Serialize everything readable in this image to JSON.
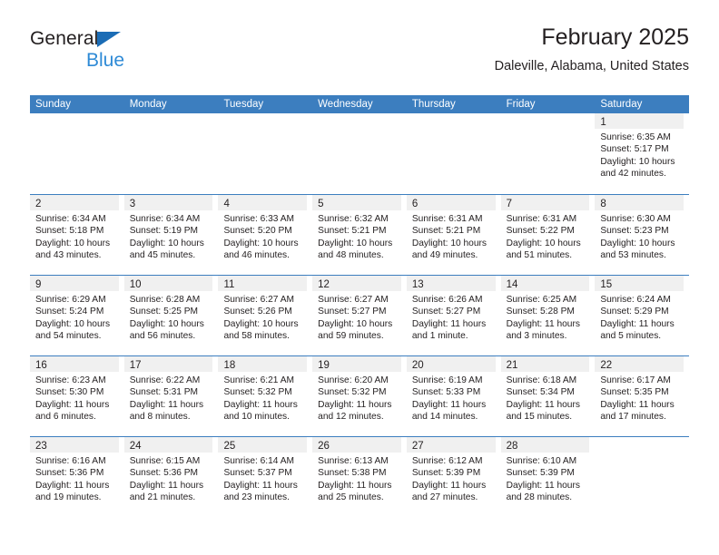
{
  "brand": {
    "name_part1": "General",
    "name_part2": "Blue",
    "triangle_icon": "triangle-icon"
  },
  "header": {
    "title": "February 2025",
    "subtitle": "Daleville, Alabama, United States"
  },
  "colors": {
    "header_blue": "#3c7ebf",
    "brand_blue": "#2e8ad6",
    "logo_triangle_blue": "#1b6cb5",
    "day_band_grey": "#f0f0f0",
    "text": "#231f20"
  },
  "calendar": {
    "weekday_headers": [
      "Sunday",
      "Monday",
      "Tuesday",
      "Wednesday",
      "Thursday",
      "Friday",
      "Saturday"
    ],
    "weeks": [
      [
        {
          "day": "",
          "lines": []
        },
        {
          "day": "",
          "lines": []
        },
        {
          "day": "",
          "lines": []
        },
        {
          "day": "",
          "lines": []
        },
        {
          "day": "",
          "lines": []
        },
        {
          "day": "",
          "lines": []
        },
        {
          "day": "1",
          "lines": [
            "Sunrise: 6:35 AM",
            "Sunset: 5:17 PM",
            "Daylight: 10 hours",
            "and 42 minutes."
          ]
        }
      ],
      [
        {
          "day": "2",
          "lines": [
            "Sunrise: 6:34 AM",
            "Sunset: 5:18 PM",
            "Daylight: 10 hours",
            "and 43 minutes."
          ]
        },
        {
          "day": "3",
          "lines": [
            "Sunrise: 6:34 AM",
            "Sunset: 5:19 PM",
            "Daylight: 10 hours",
            "and 45 minutes."
          ]
        },
        {
          "day": "4",
          "lines": [
            "Sunrise: 6:33 AM",
            "Sunset: 5:20 PM",
            "Daylight: 10 hours",
            "and 46 minutes."
          ]
        },
        {
          "day": "5",
          "lines": [
            "Sunrise: 6:32 AM",
            "Sunset: 5:21 PM",
            "Daylight: 10 hours",
            "and 48 minutes."
          ]
        },
        {
          "day": "6",
          "lines": [
            "Sunrise: 6:31 AM",
            "Sunset: 5:21 PM",
            "Daylight: 10 hours",
            "and 49 minutes."
          ]
        },
        {
          "day": "7",
          "lines": [
            "Sunrise: 6:31 AM",
            "Sunset: 5:22 PM",
            "Daylight: 10 hours",
            "and 51 minutes."
          ]
        },
        {
          "day": "8",
          "lines": [
            "Sunrise: 6:30 AM",
            "Sunset: 5:23 PM",
            "Daylight: 10 hours",
            "and 53 minutes."
          ]
        }
      ],
      [
        {
          "day": "9",
          "lines": [
            "Sunrise: 6:29 AM",
            "Sunset: 5:24 PM",
            "Daylight: 10 hours",
            "and 54 minutes."
          ]
        },
        {
          "day": "10",
          "lines": [
            "Sunrise: 6:28 AM",
            "Sunset: 5:25 PM",
            "Daylight: 10 hours",
            "and 56 minutes."
          ]
        },
        {
          "day": "11",
          "lines": [
            "Sunrise: 6:27 AM",
            "Sunset: 5:26 PM",
            "Daylight: 10 hours",
            "and 58 minutes."
          ]
        },
        {
          "day": "12",
          "lines": [
            "Sunrise: 6:27 AM",
            "Sunset: 5:27 PM",
            "Daylight: 10 hours",
            "and 59 minutes."
          ]
        },
        {
          "day": "13",
          "lines": [
            "Sunrise: 6:26 AM",
            "Sunset: 5:27 PM",
            "Daylight: 11 hours",
            "and 1 minute."
          ]
        },
        {
          "day": "14",
          "lines": [
            "Sunrise: 6:25 AM",
            "Sunset: 5:28 PM",
            "Daylight: 11 hours",
            "and 3 minutes."
          ]
        },
        {
          "day": "15",
          "lines": [
            "Sunrise: 6:24 AM",
            "Sunset: 5:29 PM",
            "Daylight: 11 hours",
            "and 5 minutes."
          ]
        }
      ],
      [
        {
          "day": "16",
          "lines": [
            "Sunrise: 6:23 AM",
            "Sunset: 5:30 PM",
            "Daylight: 11 hours",
            "and 6 minutes."
          ]
        },
        {
          "day": "17",
          "lines": [
            "Sunrise: 6:22 AM",
            "Sunset: 5:31 PM",
            "Daylight: 11 hours",
            "and 8 minutes."
          ]
        },
        {
          "day": "18",
          "lines": [
            "Sunrise: 6:21 AM",
            "Sunset: 5:32 PM",
            "Daylight: 11 hours",
            "and 10 minutes."
          ]
        },
        {
          "day": "19",
          "lines": [
            "Sunrise: 6:20 AM",
            "Sunset: 5:32 PM",
            "Daylight: 11 hours",
            "and 12 minutes."
          ]
        },
        {
          "day": "20",
          "lines": [
            "Sunrise: 6:19 AM",
            "Sunset: 5:33 PM",
            "Daylight: 11 hours",
            "and 14 minutes."
          ]
        },
        {
          "day": "21",
          "lines": [
            "Sunrise: 6:18 AM",
            "Sunset: 5:34 PM",
            "Daylight: 11 hours",
            "and 15 minutes."
          ]
        },
        {
          "day": "22",
          "lines": [
            "Sunrise: 6:17 AM",
            "Sunset: 5:35 PM",
            "Daylight: 11 hours",
            "and 17 minutes."
          ]
        }
      ],
      [
        {
          "day": "23",
          "lines": [
            "Sunrise: 6:16 AM",
            "Sunset: 5:36 PM",
            "Daylight: 11 hours",
            "and 19 minutes."
          ]
        },
        {
          "day": "24",
          "lines": [
            "Sunrise: 6:15 AM",
            "Sunset: 5:36 PM",
            "Daylight: 11 hours",
            "and 21 minutes."
          ]
        },
        {
          "day": "25",
          "lines": [
            "Sunrise: 6:14 AM",
            "Sunset: 5:37 PM",
            "Daylight: 11 hours",
            "and 23 minutes."
          ]
        },
        {
          "day": "26",
          "lines": [
            "Sunrise: 6:13 AM",
            "Sunset: 5:38 PM",
            "Daylight: 11 hours",
            "and 25 minutes."
          ]
        },
        {
          "day": "27",
          "lines": [
            "Sunrise: 6:12 AM",
            "Sunset: 5:39 PM",
            "Daylight: 11 hours",
            "and 27 minutes."
          ]
        },
        {
          "day": "28",
          "lines": [
            "Sunrise: 6:10 AM",
            "Sunset: 5:39 PM",
            "Daylight: 11 hours",
            "and 28 minutes."
          ]
        },
        {
          "day": "",
          "lines": []
        }
      ]
    ]
  }
}
